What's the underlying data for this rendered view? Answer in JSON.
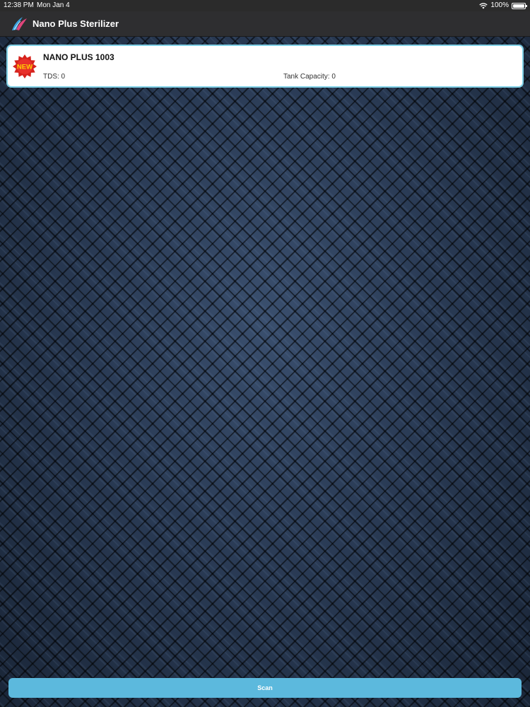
{
  "status_bar": {
    "time": "12:38 PM",
    "date": "Mon Jan 4",
    "battery": "100%",
    "icons": [
      "wifi-icon",
      "battery-icon"
    ]
  },
  "nav": {
    "title": "Nano Plus Sterilizer",
    "logo_icon": "app-logo-icon"
  },
  "device_list": [
    {
      "badge_text": "NEW",
      "badge_icon": "new-badge-icon",
      "name": "NANO PLUS 1003",
      "tds": "TDS: 0",
      "tank_capacity": "Tank Capacity: 0"
    }
  ],
  "scan_button": {
    "label": "Scan"
  },
  "colors": {
    "card_border": "#7fd0e6",
    "scan_button": "#5cb9dd",
    "badge_red": "#d6221c",
    "badge_text": "#ffd200",
    "nav_bg": "#2e2e30"
  }
}
